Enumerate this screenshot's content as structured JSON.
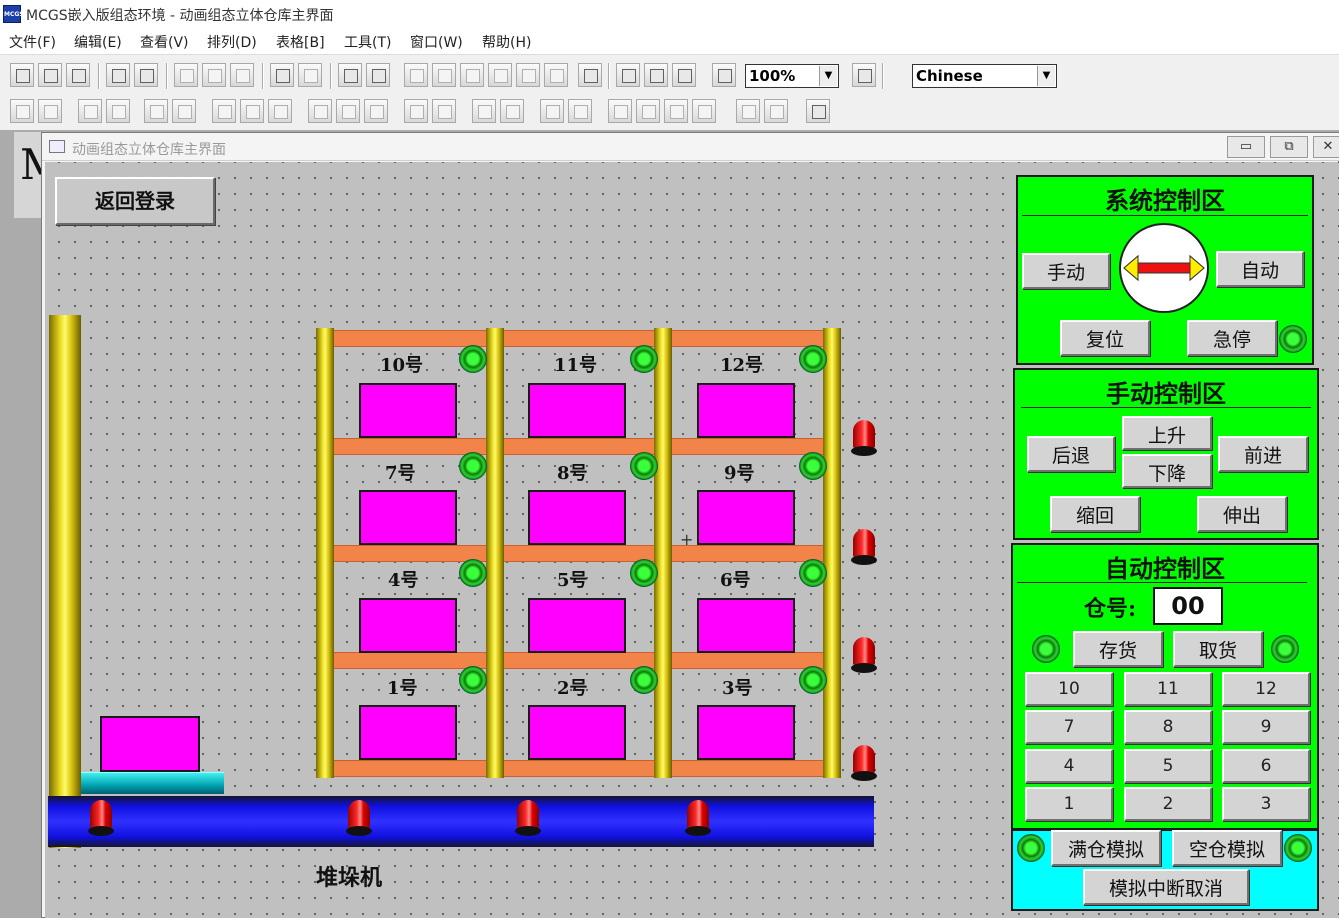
{
  "app": {
    "title": "MCGS嵌入版组态环境 - 动画组态立体仓库主界面",
    "icon_text": "MCGS"
  },
  "menu": [
    "文件(F)",
    "编辑(E)",
    "查看(V)",
    "排列(D)",
    "表格[B]",
    "工具(T)",
    "窗口(W)",
    "帮助(H)"
  ],
  "toolbar": {
    "zoom_value": "100%",
    "language_value": "Chinese"
  },
  "child_window": {
    "title": "动画组态立体仓库主界面",
    "left_strip_letter": "M"
  },
  "canvas": {
    "back_login_label": "返回登录",
    "stacker_label": "堆垛机",
    "cells": [
      {
        "label": "10号"
      },
      {
        "label": "11号"
      },
      {
        "label": "12号"
      },
      {
        "label": "7号"
      },
      {
        "label": "8号"
      },
      {
        "label": "9号"
      },
      {
        "label": "4号"
      },
      {
        "label": "5号"
      },
      {
        "label": "6号"
      },
      {
        "label": "1号"
      },
      {
        "label": "2号"
      },
      {
        "label": "3号"
      }
    ]
  },
  "system_panel": {
    "title": "系统控制区",
    "manual_label": "手动",
    "auto_label": "自动",
    "reset_label": "复位",
    "estop_label": "急停"
  },
  "manual_panel": {
    "title": "手动控制区",
    "back_label": "后退",
    "up_label": "上升",
    "down_label": "下降",
    "forward_label": "前进",
    "retract_label": "缩回",
    "extend_label": "伸出"
  },
  "auto_panel": {
    "title": "自动控制区",
    "bin_label": "仓号:",
    "bin_value": "00",
    "store_label": "存货",
    "retrieve_label": "取货",
    "number_buttons": [
      "10",
      "11",
      "12",
      "7",
      "8",
      "9",
      "4",
      "5",
      "6",
      "1",
      "2",
      "3"
    ]
  },
  "sim_panel": {
    "full_sim_label": "满仓模拟",
    "empty_sim_label": "空仓模拟",
    "cancel_sim_label": "模拟中断取消"
  },
  "colors": {
    "panel_green": "#00ff00",
    "sim_cyan": "#00ffff",
    "box_magenta": "#ff00ff",
    "beam_orange": "#f2844a",
    "conveyor_blue": "#1010e0"
  }
}
